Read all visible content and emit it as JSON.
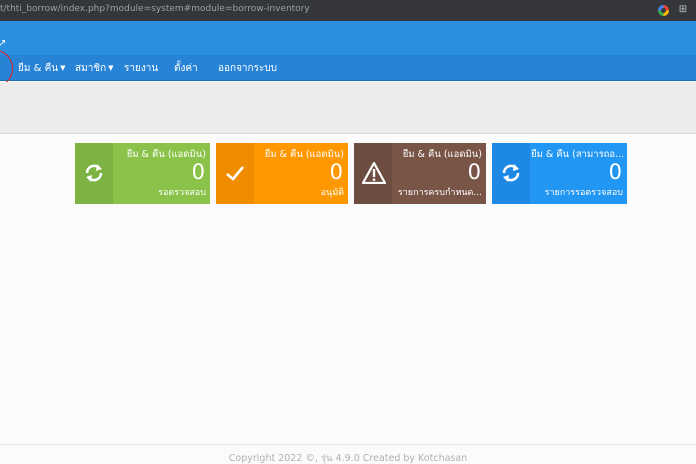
{
  "browser": {
    "url": "t/thti_borrow/index.php?module=system#module=borrow-inventory"
  },
  "nav": {
    "items": [
      {
        "label": "ยืม & คืน",
        "has_caret": true
      },
      {
        "label": "สมาชิก",
        "has_caret": true
      },
      {
        "label": "รายงาน",
        "has_caret": false
      },
      {
        "label": "ตั้งค่า",
        "has_caret": false
      },
      {
        "label": "ออกจากระบบ",
        "has_caret": false
      }
    ]
  },
  "cards": [
    {
      "title": "ยืม & คืน (แอดมิน)",
      "count": "0",
      "subtitle": "รอตรวจสอบ",
      "icon": "refresh-icon",
      "color": "#8bc34a"
    },
    {
      "title": "ยืม & คืน (แอดมิน)",
      "count": "0",
      "subtitle": "อนุมัติ",
      "icon": "check-icon",
      "color": "#ff9800"
    },
    {
      "title": "ยืม & คืน (แอดมิน)",
      "count": "0",
      "subtitle": "รายการครบกำหนด...",
      "icon": "warning-icon",
      "color": "#795548"
    },
    {
      "title": "ยืม & คืน (สามารถอ...",
      "count": "0",
      "subtitle": "รายการรอตรวจสอบ",
      "icon": "refresh-icon",
      "color": "#2196f3"
    }
  ],
  "footer": {
    "text": "Copyright 2022 ©, รุ่น 4.9.0 Created by Kotchasan"
  }
}
